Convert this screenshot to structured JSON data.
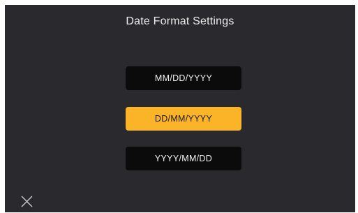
{
  "title": "Date Format Settings",
  "options": [
    {
      "label": "MM/DD/YYYY",
      "selected": false
    },
    {
      "label": "DD/MM/YYYY",
      "selected": true
    },
    {
      "label": "YYYY/MM/DD",
      "selected": false
    }
  ],
  "close_icon": "close-icon",
  "colors": {
    "background": "#2a292d",
    "option_background": "#0b0b0c",
    "accent_selected": "#fbb327",
    "text": "#ececec"
  }
}
